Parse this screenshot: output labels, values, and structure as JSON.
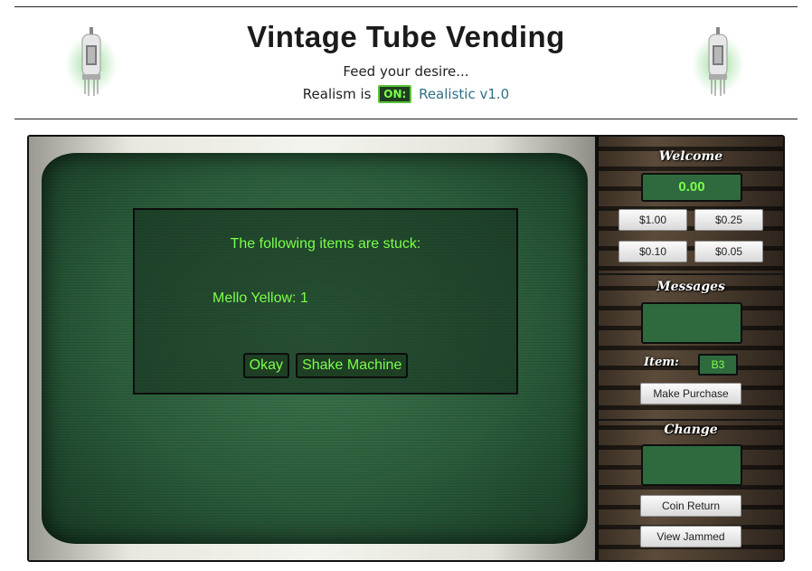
{
  "header": {
    "title": "Vintage Tube Vending",
    "tagline": "Feed your desire...",
    "realism_prefix": "Realism is",
    "realism_toggle": "ON:",
    "realism_version": "Realistic v1.0"
  },
  "colors": {
    "lcd_text": "#7bff4a",
    "lcd_bg": "#2e6a3e",
    "screen": "#2b5c3b",
    "version_link": "#2f6f86"
  },
  "dialog": {
    "message": "The following items are stuck:",
    "stuck_item": "Mello Yellow: 1",
    "okay_label": "Okay",
    "shake_label": "Shake Machine"
  },
  "panel": {
    "welcome_title": "Welcome",
    "balance": "0.00",
    "coins": [
      "$1.00",
      "$0.25",
      "$0.10",
      "$0.05"
    ],
    "messages_title": "Messages",
    "messages_text": "",
    "item_label": "Item:",
    "item_value": "B3",
    "make_purchase_label": "Make Purchase",
    "change_title": "Change",
    "change_text": "",
    "coin_return_label": "Coin Return",
    "view_jammed_label": "View Jammed"
  }
}
